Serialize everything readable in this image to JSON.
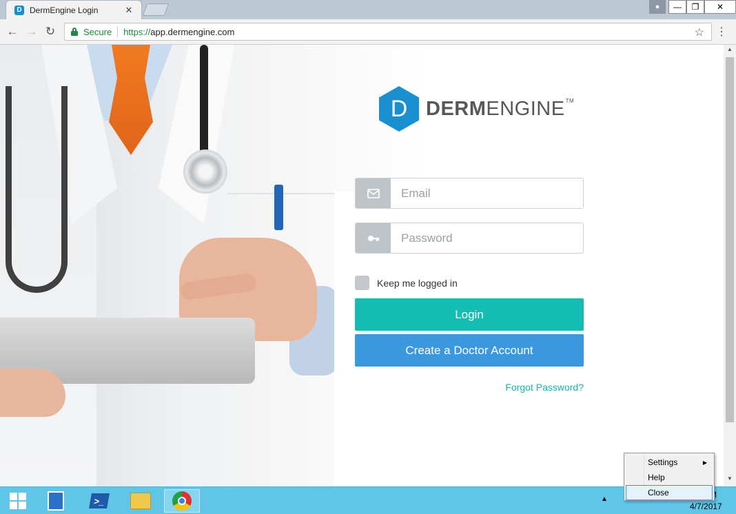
{
  "browser": {
    "tab_title": "DermEngine Login",
    "tab_favicon": "D",
    "tab_close": "✕",
    "secure_label": "Secure",
    "url_scheme": "https://",
    "url_host": "app.dermengine.com"
  },
  "window_controls": {
    "minimize": "—",
    "restore": "❐",
    "close": "✕"
  },
  "logo": {
    "mark": "D",
    "word_bold": "DERM",
    "word_light": "ENGINE",
    "tm": "TM"
  },
  "login": {
    "email_placeholder": "Email",
    "password_placeholder": "Password",
    "keep_logged_in": "Keep me logged in",
    "login_button": "Login",
    "create_account_button": "Create a Doctor Account",
    "forgot_password": "Forgot Password?"
  },
  "taskbar": {
    "clock_time": "M",
    "clock_date": "4/7/2017"
  },
  "context_menu": {
    "items": [
      {
        "label": "Settings"
      },
      {
        "label": "Help"
      },
      {
        "label": "Close"
      }
    ]
  },
  "colors": {
    "accent_teal": "#14bdb1",
    "accent_blue": "#3b98de",
    "brand_blue": "#1a8fd0",
    "taskbar": "#5fc6e8"
  },
  "icons": [
    "envelope-icon",
    "key-icon",
    "lock-icon",
    "star-icon",
    "kebab-menu-icon",
    "back-icon",
    "forward-icon",
    "reload-icon"
  ]
}
